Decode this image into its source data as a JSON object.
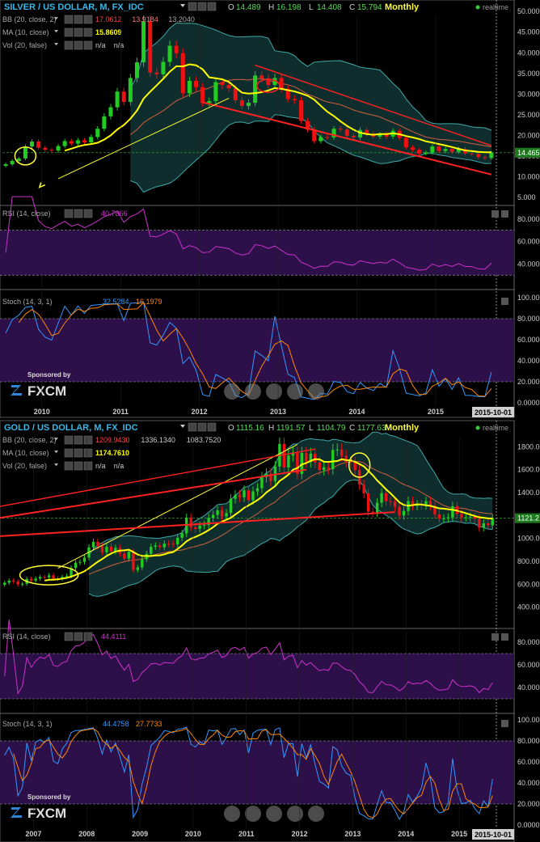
{
  "panels": [
    {
      "header": {
        "symbol": "SILVER / US DOLLAR, M, FX_IDC",
        "ohlc": {
          "o_label": "O",
          "o": "14.489",
          "h_label": "H",
          "h": "16.198",
          "l_label": "L",
          "l": "14.408",
          "c_label": "C",
          "c": "15.794"
        },
        "timeframe": "Monthly",
        "realtime": "realtime"
      },
      "indicators": [
        {
          "name": "BB (20, close, 2)",
          "values": [
            "17.0612",
            "13.9184",
            "13.2040"
          ],
          "colors": [
            "#ff4444",
            "#ff7777",
            "#aaaaaa"
          ]
        },
        {
          "name": "MA (10, close)",
          "values": [
            "15.8609"
          ],
          "colors": [
            "#ffff00"
          ]
        },
        {
          "name": "Vol (20, false)",
          "values": [
            "n/a",
            "n/a"
          ],
          "colors": [
            "#cccccc",
            "#cccccc"
          ]
        }
      ],
      "price_axis": [
        "50.0000",
        "45.0000",
        "40.0000",
        "35.0000",
        "30.0000",
        "25.0000",
        "20.0000",
        "15.0000",
        "10.0000",
        "5.000"
      ],
      "price_marker": "14.465",
      "rsi": {
        "name": "RSI (14, close)",
        "value": "40.7866",
        "axis": [
          "80.0000",
          "60.0000",
          "40.0000"
        ]
      },
      "stoch": {
        "name": "Stoch (14, 3, 1)",
        "k": "32.5284",
        "d": "16.1979",
        "axis": [
          "100.000",
          "80.0000",
          "60.0000",
          "40.0000",
          "20.0000",
          "0.0000"
        ]
      },
      "years": [
        "2010",
        "2011",
        "2012",
        "2013",
        "2014",
        "2015"
      ],
      "date_marker": "2015-10-01",
      "sponsor": {
        "line1": "Sponsored by",
        "logo": "FXCM"
      }
    },
    {
      "header": {
        "symbol": "GOLD / US DOLLAR, M, FX_IDC",
        "ohlc": {
          "o_label": "O",
          "o": "1115.16",
          "h_label": "H",
          "h": "1191.57",
          "l_label": "L",
          "l": "1104.79",
          "c_label": "C",
          "c": "1177.63"
        },
        "timeframe": "Monthly",
        "realtime": "realtime"
      },
      "indicators": [
        {
          "name": "BB (20, close, 2)",
          "values": [
            "1209.9430",
            "1336.1340",
            "1083.7520"
          ],
          "colors": [
            "#ff4444",
            "#cccccc",
            "#cccccc"
          ]
        },
        {
          "name": "MA (10, close)",
          "values": [
            "1174.7610"
          ],
          "colors": [
            "#ffff00"
          ]
        },
        {
          "name": "Vol (20, false)",
          "values": [
            "n/a",
            "n/a"
          ],
          "colors": [
            "#cccccc",
            "#cccccc"
          ]
        }
      ],
      "price_axis": [
        "1800.00",
        "1600.00",
        "1400.00",
        "1000.00",
        "800.00",
        "600.00",
        "400.00"
      ],
      "price_marker": "1121.2",
      "rsi": {
        "name": "RSI (14, close)",
        "value": "44.4111",
        "axis": [
          "80.0000",
          "60.0000",
          "40.0000"
        ]
      },
      "stoch": {
        "name": "Stoch (14, 3, 1)",
        "k": "44.4758",
        "d": "27.7733",
        "axis": [
          "100.000",
          "80.0000",
          "60.0000",
          "40.0000",
          "20.0000",
          "0.0000"
        ]
      },
      "years": [
        "2007",
        "2008",
        "2009",
        "2010",
        "2011",
        "2012",
        "2013",
        "2014",
        "2015"
      ],
      "date_marker": "2015-10-01",
      "sponsor": {
        "line1": "Sponsored by",
        "logo": "FXCM"
      }
    }
  ],
  "colors": {
    "bull": "#22cc22",
    "bear": "#ee1111",
    "ma": "#ffff00",
    "bb_line": "#3fa9a9",
    "bb_fill": "#0f2d2d",
    "rsi": "#cc33cc",
    "stoch_k": "#3399ff",
    "stoch_d": "#ff8800",
    "band": "#2d0f4a",
    "annot_red": "#ff2222",
    "annot_yellow": "#ffff33"
  },
  "chart_data": [
    {
      "type": "candlestick",
      "title": "SILVER / US DOLLAR, M, FX_IDC",
      "ylim": [
        4,
        52
      ],
      "x_start": "2009-07",
      "x_end": "2015-10",
      "close": [
        13.0,
        13.8,
        14.4,
        17.3,
        18.5,
        17.0,
        16.5,
        16.3,
        17.4,
        18.6,
        18.0,
        18.8,
        18.3,
        19.6,
        21.6,
        24.6,
        26.8,
        30.6,
        28.1,
        33.9,
        37.7,
        47.6,
        35.2,
        34.8,
        37.8,
        41.7,
        39.9,
        30.2,
        33.2,
        31.7,
        27.8,
        28.3,
        32.9,
        32.2,
        31.4,
        28.5,
        27.1,
        27.9,
        34.5,
        33.8,
        32.2,
        33.9,
        31.3,
        28.8,
        28.5,
        23.5,
        21.4,
        18.6,
        19.6,
        19.5,
        21.6,
        21.4,
        19.9,
        19.5,
        21.3,
        20.4,
        19.7,
        20.2,
        19.7,
        21.1,
        19.4,
        17.1,
        16.5,
        15.6,
        15.8,
        17.3,
        16.2,
        16.7,
        16.0,
        16.7,
        15.6,
        15.5,
        14.7,
        14.5,
        15.8
      ]
    },
    {
      "type": "candlestick",
      "title": "GOLD / US DOLLAR, M, FX_IDC",
      "ylim": [
        250,
        2000
      ],
      "x_start": "2006-06",
      "x_end": "2015-10",
      "close": [
        614,
        632,
        624,
        598,
        604,
        647,
        632,
        650,
        664,
        661,
        678,
        651,
        648,
        665,
        672,
        742,
        789,
        795,
        834,
        922,
        971,
        933,
        880,
        929,
        887,
        918,
        869,
        824,
        884,
        725,
        747,
        819,
        866,
        928,
        939,
        924,
        955,
        953,
        949,
        1006,
        1045,
        1181,
        1097,
        1084,
        1113,
        1118,
        1180,
        1206,
        1245,
        1192,
        1222,
        1346,
        1380,
        1359,
        1420,
        1333,
        1411,
        1439,
        1535,
        1564,
        1501,
        1628,
        1825,
        1620,
        1723,
        1747,
        1563,
        1747,
        1668,
        1740,
        1663,
        1596,
        1621,
        1605,
        1772,
        1776,
        1720,
        1671,
        1663,
        1596,
        1470,
        1393,
        1234,
        1223,
        1312,
        1396,
        1325,
        1323,
        1276,
        1201,
        1240,
        1326,
        1284,
        1296,
        1289,
        1326,
        1285,
        1210,
        1171,
        1174,
        1184,
        1281,
        1213,
        1183,
        1184,
        1190,
        1172,
        1095,
        1132,
        1115,
        1177
      ]
    }
  ]
}
